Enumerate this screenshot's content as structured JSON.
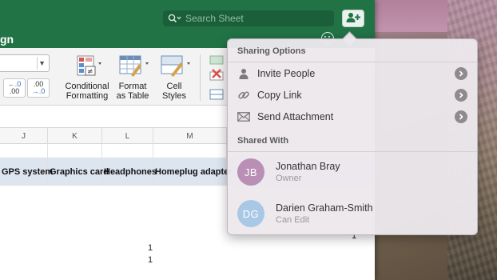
{
  "excel": {
    "search_placeholder": "Search Sheet",
    "tab_label": "gn",
    "ribbon": {
      "conditional_formatting": [
        "Conditional",
        "Formatting"
      ],
      "format_as_table": [
        "Format",
        "as Table"
      ],
      "cell_styles": [
        "Cell",
        "Styles"
      ],
      "increase_decimal": [
        "←.0",
        ".00"
      ],
      "decrease_decimal": [
        ".00",
        "→.0"
      ]
    },
    "columns": [
      "J",
      "K",
      "L",
      "M"
    ],
    "table_headers": [
      "GPS system",
      "Graphics card",
      "Headphones",
      "Homeplug adapter"
    ],
    "cell_values": [
      "1",
      "1",
      "1"
    ]
  },
  "popover": {
    "sharing_options_title": "Sharing Options",
    "menu": [
      {
        "label": "Invite People",
        "icon": "person-icon"
      },
      {
        "label": "Copy Link",
        "icon": "link-icon"
      },
      {
        "label": "Send Attachment",
        "icon": "envelope-icon"
      }
    ],
    "shared_with_title": "Shared With",
    "people": [
      {
        "initials": "JB",
        "name": "Jonathan Bray",
        "role": "Owner",
        "color": "#b98fb5"
      },
      {
        "initials": "DG",
        "name": "Darien Graham-Smith",
        "role": "Can Edit",
        "color": "#a9c8e6"
      }
    ]
  },
  "colors": {
    "excel_green": "#217346",
    "header_row_fill": "#dde5f0"
  }
}
